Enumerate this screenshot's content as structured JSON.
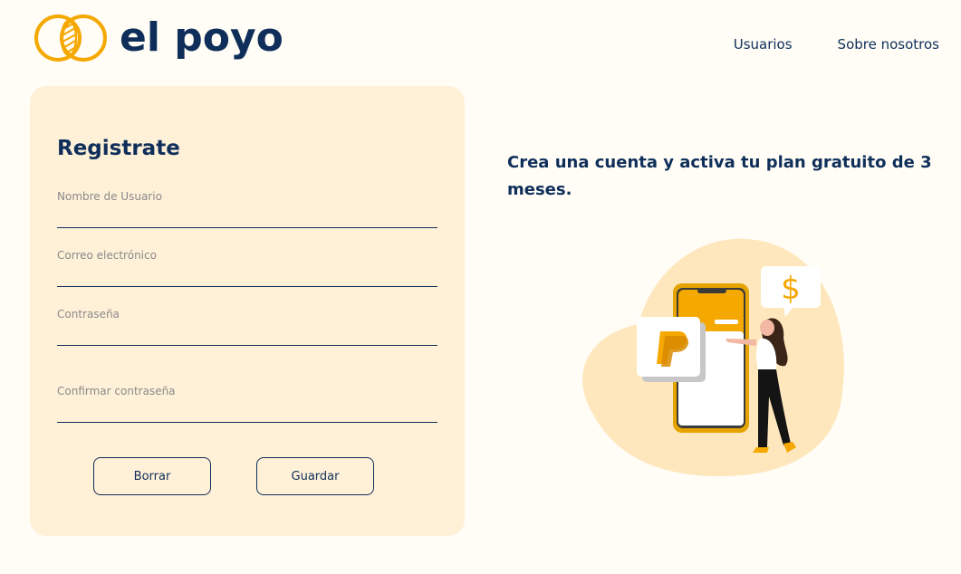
{
  "brand": {
    "name": "el poyo"
  },
  "nav": {
    "items": [
      "Usuarios",
      "Sobre nosotros"
    ]
  },
  "form": {
    "title": "Registrate",
    "fields": {
      "username": {
        "label": "Nombre de Usuario",
        "value": ""
      },
      "email": {
        "label": "Correo electrónico",
        "value": ""
      },
      "password": {
        "label": "Contraseña",
        "value": ""
      },
      "confirm": {
        "label": "Confirmar contraseña",
        "value": ""
      }
    },
    "buttons": {
      "clear": "Borrar",
      "save": "Guardar"
    }
  },
  "promo": {
    "text": "Crea una cuenta y activa tu plan gratuito de 3 meses."
  },
  "illustration": {
    "money_symbol": "$",
    "payment_icon": "paypal-icon"
  },
  "colors": {
    "accent": "#f5a800",
    "primary": "#0f2f5a",
    "card": "#fff0d8",
    "background": "#fffdf6"
  }
}
